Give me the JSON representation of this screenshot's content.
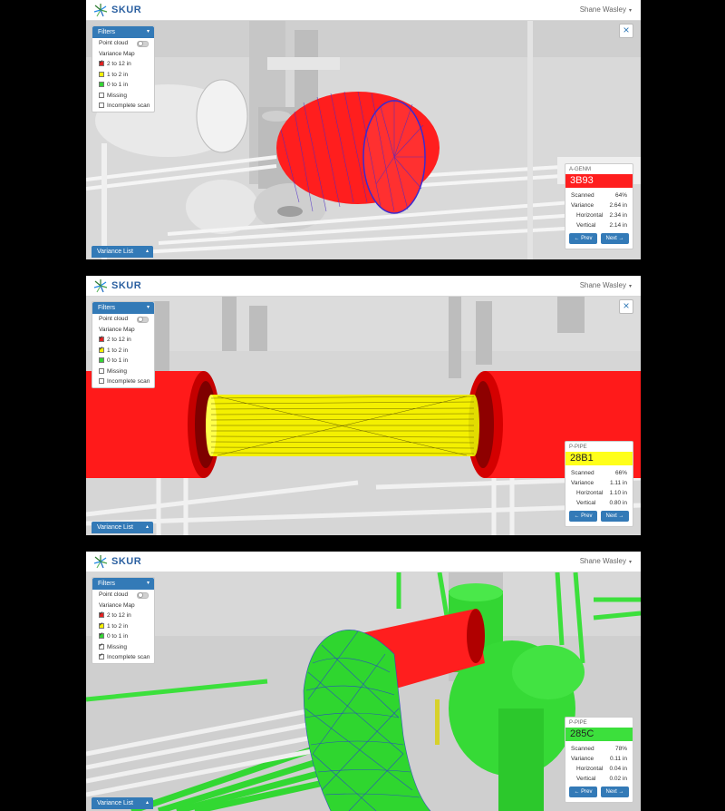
{
  "app": {
    "brand": "SKUR",
    "user": "Shane Wasley"
  },
  "filters": {
    "title": "Filters",
    "point_cloud": "Point cloud",
    "variance_map": "Variance Map",
    "range_high": "2 to 12 in",
    "range_mid": "1 to 2 in",
    "range_low": "0 to 1 in",
    "missing": "Missing",
    "incomplete": "Incomplete scan"
  },
  "variance_list": "Variance List",
  "close_icon": "×",
  "caret_down": "▾",
  "caret_up": "▴",
  "labels": {
    "scanned": "Scanned",
    "variance": "Variance",
    "horizontal": "Horizontal",
    "vertical": "Vertical",
    "prev": "← Prev",
    "next": "Next →"
  },
  "colors": {
    "accent": "#337ab7",
    "red": "#ff1e1e",
    "yellow": "#ffff1a",
    "green": "#3ce03c"
  },
  "panels": [
    {
      "type": "A-GENM",
      "id": "3B93",
      "id_color": "red",
      "scanned": "64%",
      "variance": "2.64 in",
      "horizontal": "2.34 in",
      "vertical": "2.14 in"
    },
    {
      "type": "P-PIPE",
      "id": "28B1",
      "id_color": "yellow",
      "scanned": "66%",
      "variance": "1.11 in",
      "horizontal": "1.10 in",
      "vertical": "0.80 in"
    },
    {
      "type": "P-PIPE",
      "id": "285C",
      "id_color": "green",
      "scanned": "78%",
      "variance": "0.11 in",
      "horizontal": "0.04 in",
      "vertical": "0.02 in"
    }
  ]
}
